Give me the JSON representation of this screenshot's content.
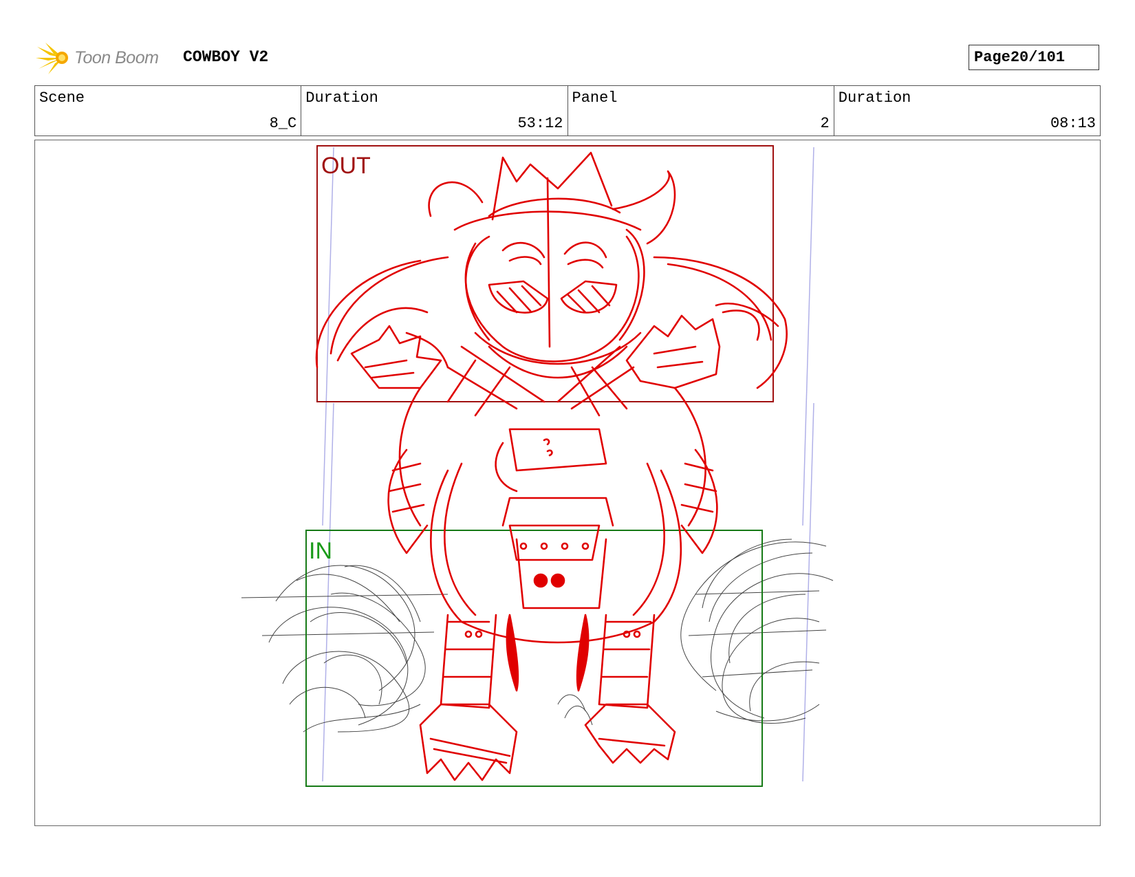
{
  "header": {
    "logo_text": "Toon Boom",
    "project_title": "COWBOY V2",
    "page_label": "Page",
    "page_number": "20/101"
  },
  "info": {
    "scene_label": "Scene",
    "scene_value": "8_C",
    "scene_duration_label": "Duration",
    "scene_duration_value": "53:12",
    "panel_label": "Panel",
    "panel_value": "2",
    "panel_duration_label": "Duration",
    "panel_duration_value": "08:13"
  },
  "panel": {
    "out_label": "OUT",
    "in_label": "IN",
    "colors": {
      "out_frame": "#a01010",
      "in_frame": "#167a16",
      "sketch": "#e00000",
      "dust": "#222222",
      "guide": "#b0b0e8"
    }
  }
}
